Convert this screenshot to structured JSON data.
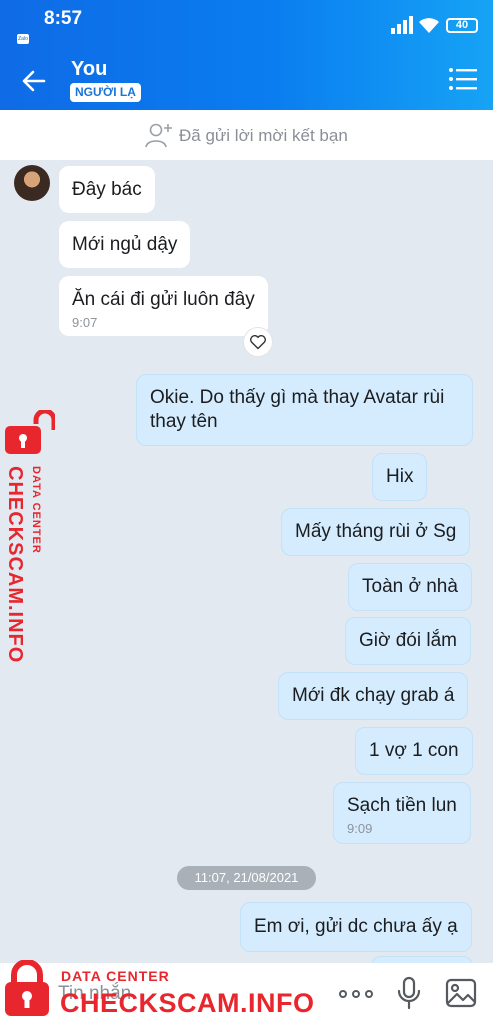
{
  "status": {
    "time": "8:57",
    "app_badge": "Zalo",
    "battery": "40"
  },
  "header": {
    "title": "You",
    "tag": "NGƯỜI LẠ"
  },
  "friend_bar": {
    "text": "Đã gửi lời mời kết bạn"
  },
  "messages": [
    {
      "text": "Đây bác"
    },
    {
      "text": "Mới ngủ dậy"
    },
    {
      "text": "Ăn cái đi gửi luôn đây",
      "time": "9:07"
    },
    {
      "line1": "Okie. Do thấy gì mà thay Avatar rùi",
      "line2": "thay tên"
    },
    {
      "text": "Hix"
    },
    {
      "text": "Mấy tháng rùi ở Sg"
    },
    {
      "text": "Toàn ở nhà"
    },
    {
      "text": "Giờ đói lắm"
    },
    {
      "text": "Mới đk chạy grab á"
    },
    {
      "text": "1 vợ 1 con"
    },
    {
      "text": "Sạch tiền lun",
      "time": "9:09"
    },
    {
      "text": "Em ơi, gửi dc chưa ấy ạ"
    }
  ],
  "date_separator": "11:07, 21/08/2021",
  "composer": {
    "placeholder": "Tin nhắn"
  },
  "watermark": {
    "top": "DATA CENTER",
    "brand": "CHECKSCAM.INFO"
  },
  "colors": {
    "header_blue": "#0a7df0",
    "outgoing_bubble": "#d4ecfd",
    "watermark_red": "#e8262d",
    "background": "#e2e9f1"
  },
  "icons": [
    "back-arrow-icon",
    "menu-list-icon",
    "add-friend-icon",
    "heart-icon",
    "more-icon",
    "mic-icon",
    "image-icon",
    "lock-icon"
  ]
}
